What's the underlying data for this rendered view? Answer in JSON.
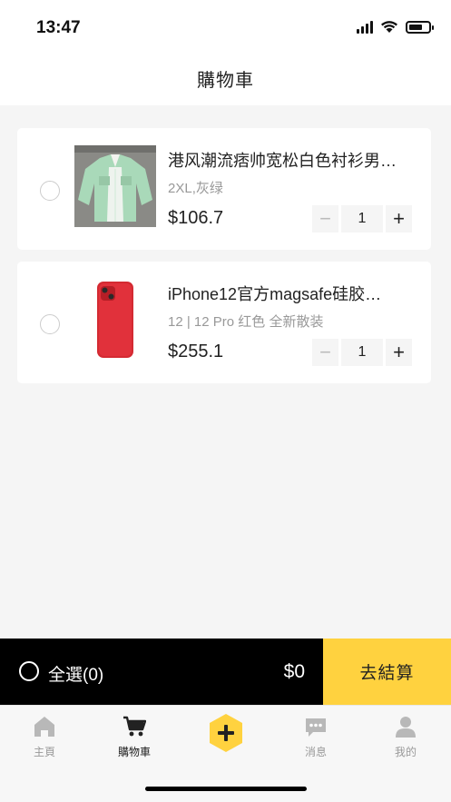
{
  "status_bar": {
    "time": "13:47"
  },
  "header": {
    "title": "購物車"
  },
  "cart": {
    "items": [
      {
        "title": "港风潮流痞帅宽松白色衬衫男…",
        "spec": "2XL,灰绿",
        "price": "$106.7",
        "quantity": "1"
      },
      {
        "title": "iPhone12官方magsafe硅胶…",
        "spec": "12 | 12 Pro 红色 全新散装",
        "price": "$255.1",
        "quantity": "1"
      }
    ]
  },
  "checkout": {
    "select_all_label": "全選(0)",
    "total": "$0",
    "button_label": "去結算",
    "accent_color": "#ffd23f"
  },
  "tabbar": {
    "home_label": "主頁",
    "cart_label": "購物車",
    "messages_label": "消息",
    "me_label": "我的"
  }
}
